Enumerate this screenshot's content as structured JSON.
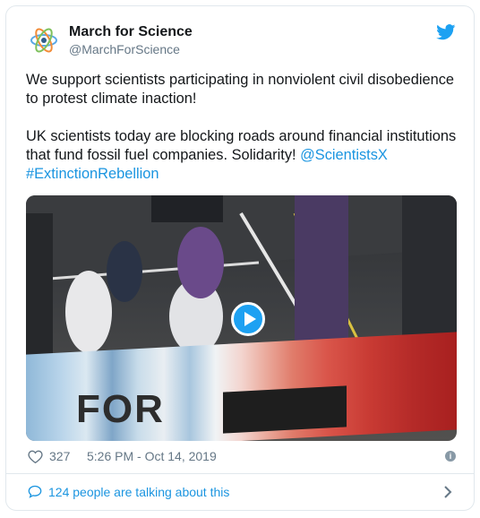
{
  "tweet": {
    "author_name": "March for Science",
    "author_handle": "@MarchForScience",
    "paragraph1": "We support scientists participating in nonviolent civil disobedience to protest climate inaction!",
    "paragraph2_text": "UK scientists today are blocking roads around financial institutions that fund fossil fuel companies. Solidarity!",
    "mention": "@ScientistsX",
    "hashtag": "#ExtinctionRebellion",
    "media": {
      "banner_text": "FOR",
      "icon": "play-icon"
    },
    "likes": "327",
    "timestamp": "5:26 PM - Oct 14, 2019"
  },
  "footer": {
    "talking_label": "124 people are talking about this"
  },
  "icons": {
    "brand": "twitter-bird-icon",
    "like": "heart-icon",
    "info": "info-icon",
    "reply": "speech-bubble-icon",
    "next": "chevron-right-icon"
  },
  "colors": {
    "accent": "#1da1f2",
    "link": "#1b95e0",
    "secondary_text": "#657786",
    "border": "#e1e8ed"
  }
}
